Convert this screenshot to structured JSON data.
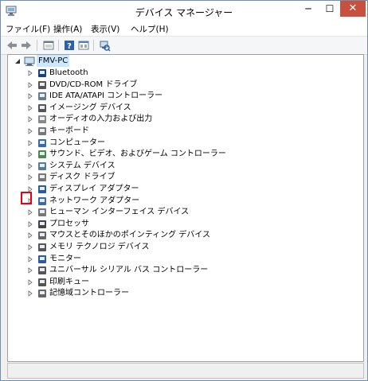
{
  "window": {
    "title": "デバイス マネージャー"
  },
  "menu": [
    "ファイル(F)",
    "操作(A)",
    "表示(V)",
    "ヘルプ(H)"
  ],
  "tree": {
    "root": "FMV-PC",
    "items": [
      "Bluetooth",
      "DVD/CD-ROM ドライブ",
      "IDE ATA/ATAPI コントローラー",
      "イメージング デバイス",
      "オーディオの入力および出力",
      "キーボード",
      "コンピューター",
      "サウンド、ビデオ、およびゲーム コントローラー",
      "システム デバイス",
      "ディスク ドライブ",
      "ディスプレイ アダプター",
      "ネットワーク アダプター",
      "ヒューマン インターフェイス デバイス",
      "プロセッサ",
      "マウスとそのほかのポインティング デバイス",
      "メモリ テクノロジ デバイス",
      "モニター",
      "ユニバーサル シリアル バス コントローラー",
      "印刷キュー",
      "記憶域コントローラー"
    ]
  },
  "colors": {
    "highlight": "#e60012",
    "selection": "#cce8ff",
    "close_button": "#c7503f"
  }
}
